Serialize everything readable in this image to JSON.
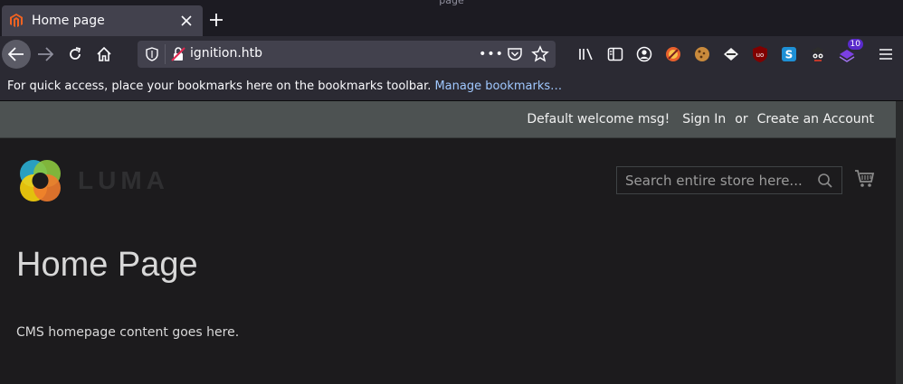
{
  "window": {
    "title": "page"
  },
  "tab": {
    "title": "Home page",
    "favicon": "magento-icon"
  },
  "urlbar": {
    "url": "ignition.htb",
    "more": "•••"
  },
  "toolbar": {
    "extensions_badge": "10",
    "icons": [
      "library-icon",
      "sidebar-icon",
      "account-icon",
      "extension-icon",
      "cookie-icon",
      "extension-icon",
      "ublock-icon",
      "extension-icon",
      "extension-icon",
      "extension-icon"
    ]
  },
  "bookmarks": {
    "prompt": "For quick access, place your bookmarks here on the bookmarks toolbar.",
    "manage": "Manage bookmarks…"
  },
  "header": {
    "welcome": "Default welcome msg!",
    "sign_in": "Sign In",
    "or": "or",
    "create_account": "Create an Account"
  },
  "logo": {
    "text": "LUMA"
  },
  "search": {
    "placeholder": "Search entire store here..."
  },
  "main": {
    "title": "Home Page",
    "content": "CMS homepage content goes here."
  },
  "colors": {
    "header_panel": "#4d5252",
    "page_bg": "#1c1b1d",
    "browser_chrome": "#2b2a33",
    "tab_active": "#42414d",
    "link": "#a0c8ff"
  }
}
